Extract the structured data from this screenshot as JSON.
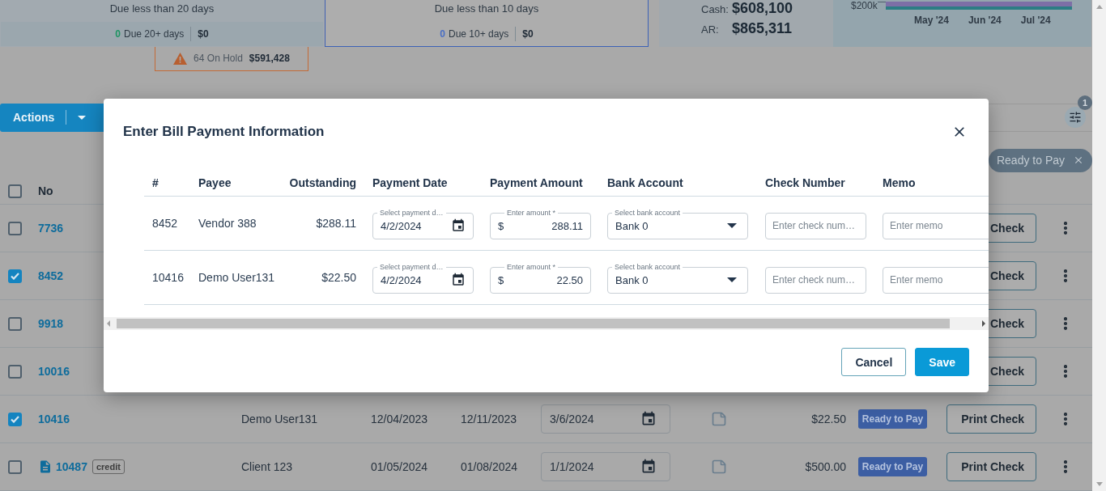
{
  "summary_cards": [
    {
      "title": "Due less than 20 days",
      "count": "0",
      "count_label": "Due 20+ days",
      "amount": "$0",
      "selected": false,
      "color": "#1e9463"
    },
    {
      "title": "Due less than 10 days",
      "count": "0",
      "count_label": "Due 10+ days",
      "amount": "$0",
      "selected": true,
      "color": "#4a6fc4"
    }
  ],
  "balances": [
    {
      "label": "Cash:",
      "value": "$608,100"
    },
    {
      "label": "AR:",
      "value": "$865,311"
    }
  ],
  "chart_card": {
    "y_tick": "$200k",
    "x_labels": [
      "May '24",
      "Jun '24",
      "Jul '24"
    ]
  },
  "on_hold": {
    "count_label": "64 On Hold",
    "amount": "$591,428"
  },
  "toolbar": {
    "actions_label": "Actions",
    "filter_count": "1"
  },
  "filter_chips": [
    {
      "label": "Ready to Pay"
    }
  ],
  "table": {
    "header": {
      "checked": false,
      "no": "No"
    },
    "rows": [
      {
        "no": "7736",
        "checked": false,
        "attachment": false,
        "button": "Check"
      },
      {
        "no": "8452",
        "checked": true,
        "attachment": false,
        "button": "Check"
      },
      {
        "no": "9918",
        "checked": false,
        "attachment": false,
        "button": "Check"
      },
      {
        "no": "10016",
        "checked": false,
        "attachment": false,
        "button": "Check"
      },
      {
        "no": "10416",
        "checked": true,
        "attachment": false,
        "payee": "Demo User131",
        "date_1": "12/04/2023",
        "date_2": "12/11/2023",
        "pay_date": "3/6/2024",
        "amount": "$22.50",
        "status": "Ready to Pay",
        "button": "Print Check"
      },
      {
        "no": "10487",
        "checked": false,
        "attachment": true,
        "tag": "credit",
        "payee": "Client 123",
        "date_1": "01/05/2024",
        "date_2": "01/08/2024",
        "pay_date": "1/1/2024",
        "amount": "$500.00",
        "status": "Ready to Pay",
        "button": "Print Check"
      }
    ]
  },
  "modal": {
    "title": "Enter Bill Payment Information",
    "columns": [
      "#",
      "Payee",
      "Outstanding",
      "Payment Date",
      "Payment Amount",
      "Bank Account",
      "Check Number",
      "Memo"
    ],
    "rows": [
      {
        "no": "8452",
        "payee": "Vendor 388",
        "outstanding": "$288.11",
        "date_label": "Select payment d…",
        "date": "4/2/2024",
        "amount_label": "Enter amount *",
        "currency": "$",
        "amount": "288.11",
        "bank_label": "Select bank account",
        "bank": "Bank 0",
        "check_placeholder": "Enter check num…",
        "memo_placeholder": "Enter memo"
      },
      {
        "no": "10416",
        "payee": "Demo User131",
        "outstanding": "$22.50",
        "date_label": "Select payment d…",
        "date": "4/2/2024",
        "amount_label": "Enter amount *",
        "currency": "$",
        "amount": "22.50",
        "bank_label": "Select bank account",
        "bank": "Bank 0",
        "check_placeholder": "Enter check num…",
        "memo_placeholder": "Enter memo"
      }
    ],
    "buttons": [
      {
        "label": "Cancel",
        "kind": "secondary"
      },
      {
        "label": "Save",
        "kind": "primary"
      }
    ]
  }
}
